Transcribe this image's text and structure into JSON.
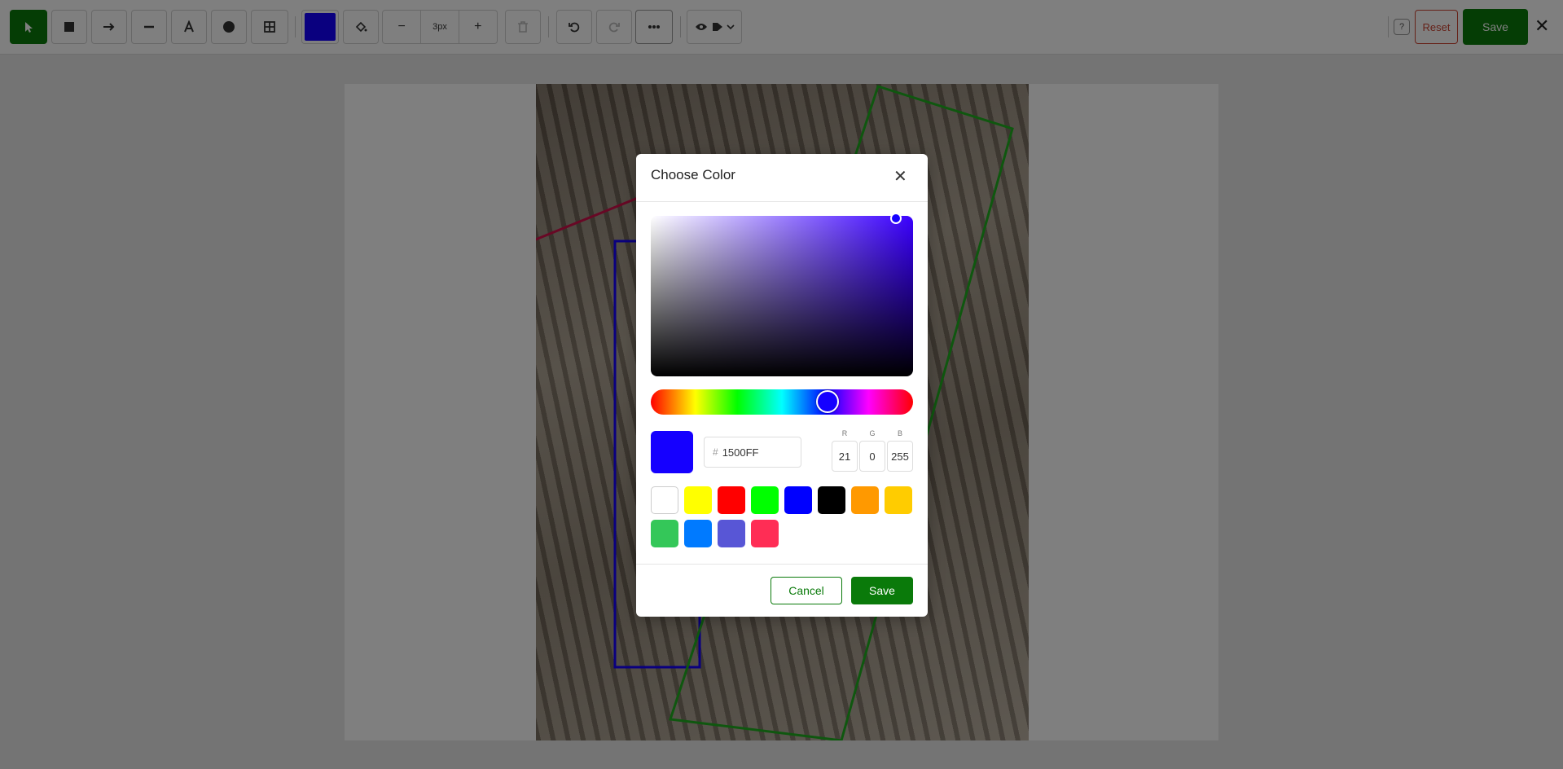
{
  "toolbar": {
    "color_value": "#1500FF",
    "stroke_width": "3px",
    "zoom_minus": "−",
    "zoom_plus": "+",
    "help_label": "?",
    "reset_label": "Reset",
    "save_label": "Save",
    "close_label": "✕",
    "tools": [
      "select-icon",
      "rectangle-icon",
      "arrow-icon",
      "line-icon",
      "text-icon",
      "circle-icon",
      "grid-icon"
    ]
  },
  "colors": {
    "brand": "#0a7a0a",
    "danger": "#cc4433"
  },
  "modal": {
    "title": "Choose Color",
    "close_label": "✕",
    "hex_prefix": "#",
    "hex_value": "1500FF",
    "rgb": {
      "r_label": "R",
      "r_value": "21",
      "g_label": "G",
      "g_value": "0",
      "b_label": "B",
      "b_value": "255"
    },
    "presets": [
      "#ffffff",
      "#ffff00",
      "#ff0000",
      "#00ff00",
      "#0000ff",
      "#000000",
      "#ff9900",
      "#ffcc00",
      "#34c759",
      "#007aff",
      "#5856d6",
      "#ff2d55"
    ],
    "cancel_label": "Cancel",
    "save_label": "Save"
  }
}
